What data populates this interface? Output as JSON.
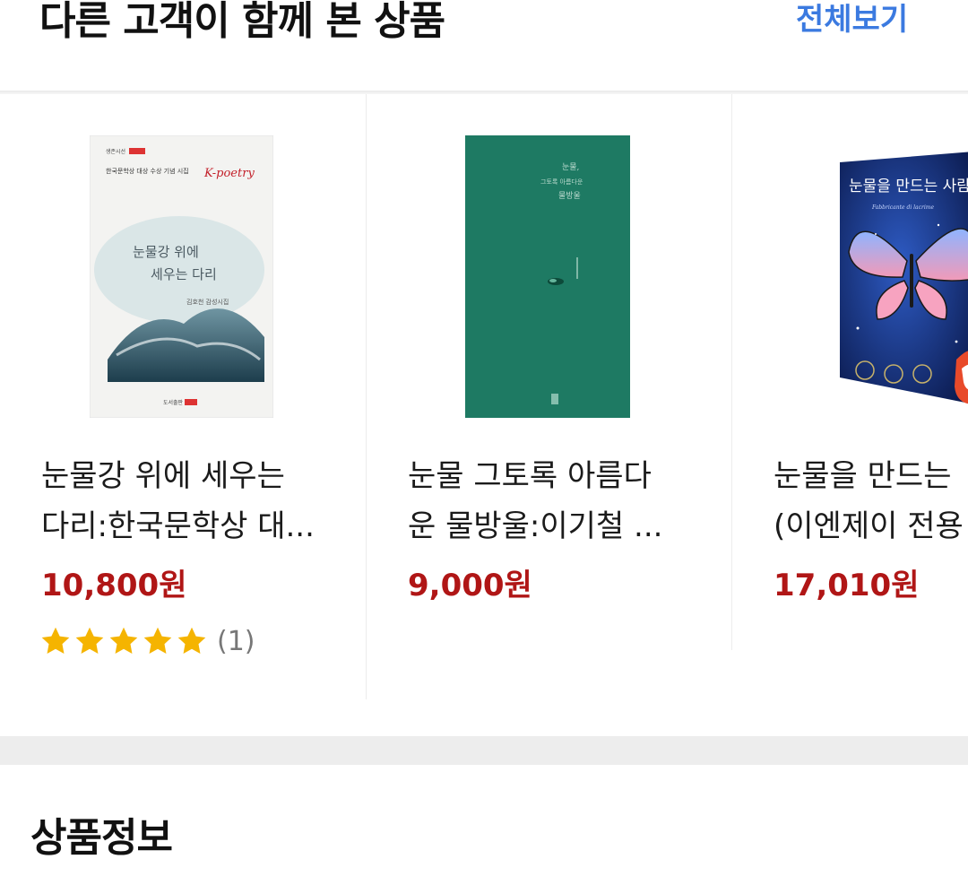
{
  "header": {
    "title": "다른 고객이 함께 본 상품",
    "view_all": "전체보기"
  },
  "products": [
    {
      "title_line1": "눈물강 위에 세우는",
      "title_line2": "다리:한국문학상 대...",
      "price": "10,800원",
      "rating": 5,
      "review_count": "(1)",
      "cover": {
        "series": "한국문학상 대상 수상 기념 시집",
        "badge": "K-poetry",
        "title_line1": "눈물강 위에",
        "title_line2": "세우는 다리",
        "author": "김호천 감성시집",
        "publisher": "도서출판"
      }
    },
    {
      "title_line1": "눈물 그토록 아름다",
      "title_line2": "운 물방울:이기철 ...",
      "price": "9,000원",
      "cover": {
        "title_line1": "눈물,",
        "title_line2": "그토록 아름다운",
        "title_line3": "물방울"
      }
    },
    {
      "title_line1": "눈물을 만드는",
      "title_line2": "(이엔제이 전용",
      "price": "17,010원",
      "cover": {
        "title": "눈물을 만드는 사람",
        "subtitle": "Fabbricante di lacrime"
      }
    }
  ],
  "section": {
    "title": "상품정보"
  },
  "colors": {
    "accent": "#3b7ae0",
    "price": "#b01616",
    "star": "#f5b400"
  }
}
